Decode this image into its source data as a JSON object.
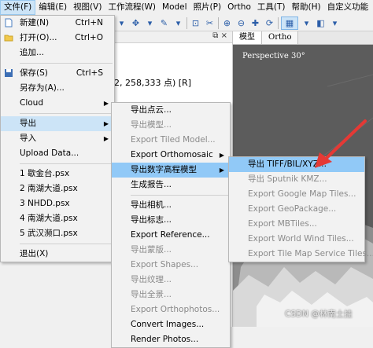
{
  "menubar": [
    "文件(F)",
    "编辑(E)",
    "视图(V)",
    "工作流程(W)",
    "Model",
    "照片(P)",
    "Ortho",
    "工具(T)",
    "帮助(H)",
    "自定义功能"
  ],
  "panel": {
    "close_label": "⧉ ×",
    "summary_text": "2, 258,333 点) [R]"
  },
  "viewport": {
    "tabs": [
      "模型",
      "Ortho"
    ],
    "view_label": "Perspective 30°",
    "watermark": "CSDN @林南土挂"
  },
  "file_menu": [
    {
      "label": "新建(N)",
      "shortcut": "Ctrl+N",
      "icon": "new-file-icon"
    },
    {
      "label": "打开(O)...",
      "shortcut": "Ctrl+O",
      "icon": "open-folder-icon"
    },
    {
      "label": "追加..."
    },
    {
      "label": "保存(S)",
      "shortcut": "Ctrl+S",
      "icon": "save-icon"
    },
    {
      "label": "另存为(A)..."
    },
    {
      "label": "Cloud",
      "submenu": true
    },
    {
      "label": "导出",
      "submenu": true,
      "highlighted": true
    },
    {
      "label": "导入",
      "submenu": true
    },
    {
      "label": "Upload Data..."
    },
    {
      "label": "1 歇金台.psx"
    },
    {
      "label": "2 南湖大道.psx"
    },
    {
      "label": "3 NHDD.psx"
    },
    {
      "label": "4 南湖大道.psx"
    },
    {
      "label": "5 武汉濒口.psx"
    },
    {
      "label": "退出(X)"
    }
  ],
  "export_menu": [
    {
      "label": "导出点云..."
    },
    {
      "label": "导出模型...",
      "disabled": true
    },
    {
      "label": "Export Tiled Model...",
      "disabled": true
    },
    {
      "label": "Export Orthomosaic",
      "submenu": true
    },
    {
      "label": "导出数字高程模型",
      "submenu": true,
      "highlighted": true
    },
    {
      "label": "生成报告..."
    },
    {
      "label": "导出相机..."
    },
    {
      "label": "导出标志..."
    },
    {
      "label": "Export Reference..."
    },
    {
      "label": "导出蒙版...",
      "disabled": true
    },
    {
      "label": "Export Shapes...",
      "disabled": true
    },
    {
      "label": "导出纹理...",
      "disabled": true
    },
    {
      "label": "导出全景...",
      "disabled": true
    },
    {
      "label": "Export Orthophotos...",
      "disabled": true
    },
    {
      "label": "Convert Images..."
    },
    {
      "label": "Render Photos..."
    }
  ],
  "dem_menu": [
    {
      "label": "导出 TIFF/BIL/XYZ...",
      "highlighted": true
    },
    {
      "label": "导出 Sputnik KMZ...",
      "disabled": true
    },
    {
      "label": "Export Google Map Tiles...",
      "disabled": true
    },
    {
      "label": "Export GeoPackage...",
      "disabled": true
    },
    {
      "label": "Export MBTiles...",
      "disabled": true
    },
    {
      "label": "Export World Wind Tiles...",
      "disabled": true
    },
    {
      "label": "Export Tile Map Service Tiles...",
      "disabled": true
    }
  ],
  "colors": {
    "menu_highlight": "#91c9f7",
    "arrow": "#e53935",
    "viewport_bg": "#5c5c5c"
  }
}
